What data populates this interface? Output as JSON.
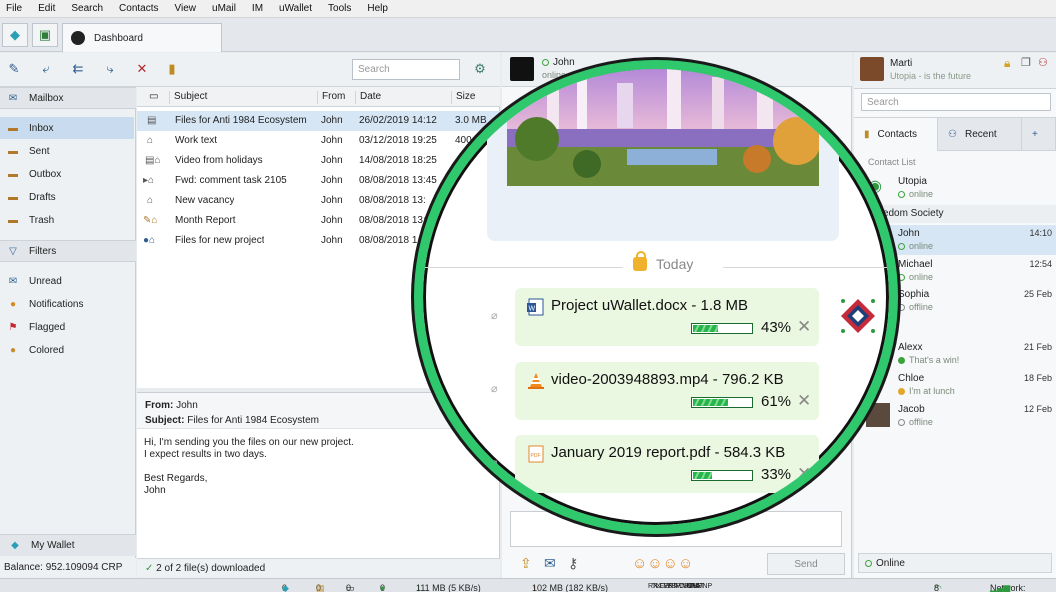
{
  "menu": [
    "File",
    "Edit",
    "Search",
    "Contacts",
    "View",
    "uMail",
    "IM",
    "uWallet",
    "Tools",
    "Help"
  ],
  "tabs": {
    "dashboard": "Dashboard"
  },
  "mail": {
    "search_placeholder": "Search",
    "sidebar": {
      "mailbox": "Mailbox",
      "inbox": "Inbox",
      "sent": "Sent",
      "outbox": "Outbox",
      "drafts": "Drafts",
      "trash": "Trash",
      "filters": "Filters",
      "unread": "Unread",
      "notifications": "Notifications",
      "flagged": "Flagged",
      "colored": "Colored",
      "my_wallet": "My Wallet",
      "balance": "Balance: 952.109094 CRP"
    },
    "columns": {
      "subject": "Subject",
      "from": "From",
      "date": "Date",
      "size": "Size"
    },
    "rows": [
      {
        "subject": "Files for Anti 1984 Ecosystem",
        "from": "John",
        "date": "26/02/2019 14:12",
        "size": "3.0 MB"
      },
      {
        "subject": "Work text",
        "from": "John",
        "date": "03/12/2018 19:25",
        "size": "400"
      },
      {
        "subject": "Video from holidays",
        "from": "John",
        "date": "14/08/2018 18:25",
        "size": ""
      },
      {
        "subject": "Fwd: comment task 2105",
        "from": "John",
        "date": "08/08/2018 13:45",
        "size": ""
      },
      {
        "subject": "New vacancy",
        "from": "John",
        "date": "08/08/2018 13:",
        "size": ""
      },
      {
        "subject": "Month Report",
        "from": "John",
        "date": "08/08/2018 13:",
        "size": ""
      },
      {
        "subject": "Files for new project",
        "from": "John",
        "date": "08/08/2018 1",
        "size": ""
      }
    ],
    "preview": {
      "from_label": "From:",
      "from": "John",
      "subject_label": "Subject:",
      "subject": "Files for Anti 1984 Ecosystem",
      "body": "Hi, I'm sending you the files on our new project.\nI expect results in two days.\n\nBest Regards,\nJohn"
    },
    "downloaded": "2 of 2 file(s) downloaded"
  },
  "chat": {
    "peer": "John",
    "peer_status": "online",
    "today": "Today",
    "send": "Send",
    "files": [
      {
        "name": "Project uWallet.docx - 1.8 MB",
        "progress": 43,
        "progress_label": "43%",
        "icon": "word-doc-icon"
      },
      {
        "name": "video-2003948893.mp4 - 796.2 KB",
        "progress": 61,
        "progress_label": "61%",
        "icon": "vlc-cone-icon"
      },
      {
        "name": "January 2019 report.pdf - 584.3 KB",
        "progress": 33,
        "progress_label": "33%",
        "icon": "pdf-icon"
      }
    ]
  },
  "contacts": {
    "me_name": "Marti",
    "me_status": "Utopia - is the future",
    "search_placeholder": "Search",
    "tab_contacts": "Contacts",
    "tab_recent": "Recent",
    "list_label": "Contact List",
    "group1": "reedom Society",
    "items": [
      {
        "name": "Utopia",
        "status": "online",
        "time": ""
      },
      {
        "name": "John",
        "status": "online",
        "time": "14:10"
      },
      {
        "name": "Michael",
        "status": "online",
        "time": "12:54"
      },
      {
        "name": "Sophia",
        "status": "offline",
        "time": "25 Feb"
      },
      {
        "name": "Alexx",
        "status": "That's a win!",
        "time": "21 Feb"
      },
      {
        "name": "Chloe",
        "status": "I'm at lunch",
        "time": "18 Feb"
      },
      {
        "name": "Jacob",
        "status": "offline",
        "time": "12 Feb"
      }
    ],
    "online": "Online"
  },
  "status": {
    "c1": "0",
    "c2": "0",
    "c3": "0",
    "c4": "0",
    "down": "111 MB (5 KB/s)",
    "up": "102 MB (182 KB/s)",
    "flags": [
      "RX",
      "TX",
      "LC",
      "FW",
      "ER",
      "BT",
      "BP",
      "MNG",
      "CRP",
      "UCH",
      "UNS",
      "NAT",
      "UPNP"
    ],
    "peers": "8",
    "network": "Network:"
  },
  "colors": {
    "accent_green": "#2fc86c",
    "selection_blue": "#c9dcef",
    "bubble_green": "#eaf7e1"
  }
}
